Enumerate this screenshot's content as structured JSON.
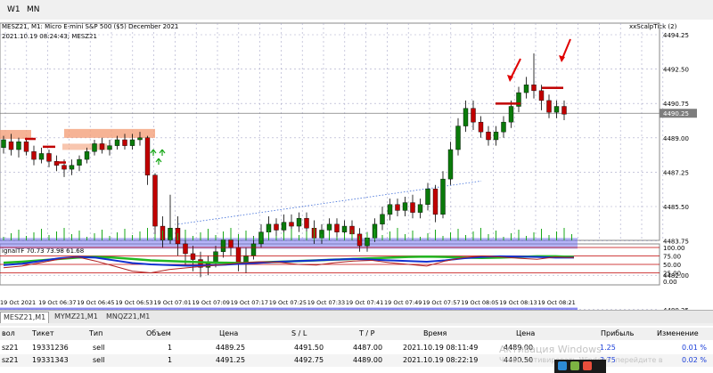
{
  "timeframes": [
    "W1",
    "MN"
  ],
  "chart": {
    "symbol_line": "MESZ21, M1:  Micro E-mini S&P 500 ($5) December 2021",
    "timestamp_line": "2021.10.19 08:24:43; MESZ21",
    "indicator_name": "xxScalpTick (2)",
    "oscillator_label": "ignalTF 70.73 73.98 61.68",
    "price_ticks": [
      "4494.25",
      "4492.50",
      "4490.75",
      "4489.00",
      "4487.25",
      "4485.50",
      "4483.75",
      "4482.00",
      "4480.25"
    ],
    "current_price": "4490.25",
    "osc_ticks": [
      "100.00",
      "75.00",
      "50.00",
      "25.00",
      "0.00"
    ],
    "time_labels": [
      "19 Oct 2021",
      "19 Oct 06:37",
      "19 Oct 06:45",
      "19 Oct 06:53",
      "19 Oct 07:01",
      "19 Oct 07:09",
      "19 Oct 07:17",
      "19 Oct 07:25",
      "19 Oct 07:33",
      "19 Oct 07:41",
      "19 Oct 07:49",
      "19 Oct 07:57",
      "19 Oct 08:05",
      "19 Oct 08:13",
      "19 Oct 08:21"
    ],
    "colors": {
      "bull": "#0a7a0a",
      "bear": "#c00000",
      "zone": "#7777ee",
      "supply": "#f4a07a"
    }
  },
  "tabs": [
    "MESZ21,M1",
    "MYMZ21,M1",
    "MNQZ21,M1"
  ],
  "table": {
    "headers": [
      "вол",
      "Тикет",
      "Тип",
      "Объем",
      "Цена",
      "S / L",
      "T / P",
      "Время",
      "Цена",
      "Прибыль",
      "Изменение"
    ],
    "rows": [
      [
        "sz21",
        "19331236",
        "sell",
        "1",
        "4489.25",
        "4491.50",
        "4487.00",
        "2021.10.19 08:11:49",
        "4489.00",
        "1.25",
        "0.01 %"
      ],
      [
        "sz21",
        "19331343",
        "sell",
        "1",
        "4491.25",
        "4492.75",
        "4489.00",
        "2021.10.19 08:22:19",
        "4490.50",
        "3.75",
        "0.02 %"
      ]
    ]
  },
  "watermark": {
    "title": "Активация Windows",
    "subtitle": "Чтобы активировать Windows, перейдите в"
  }
}
